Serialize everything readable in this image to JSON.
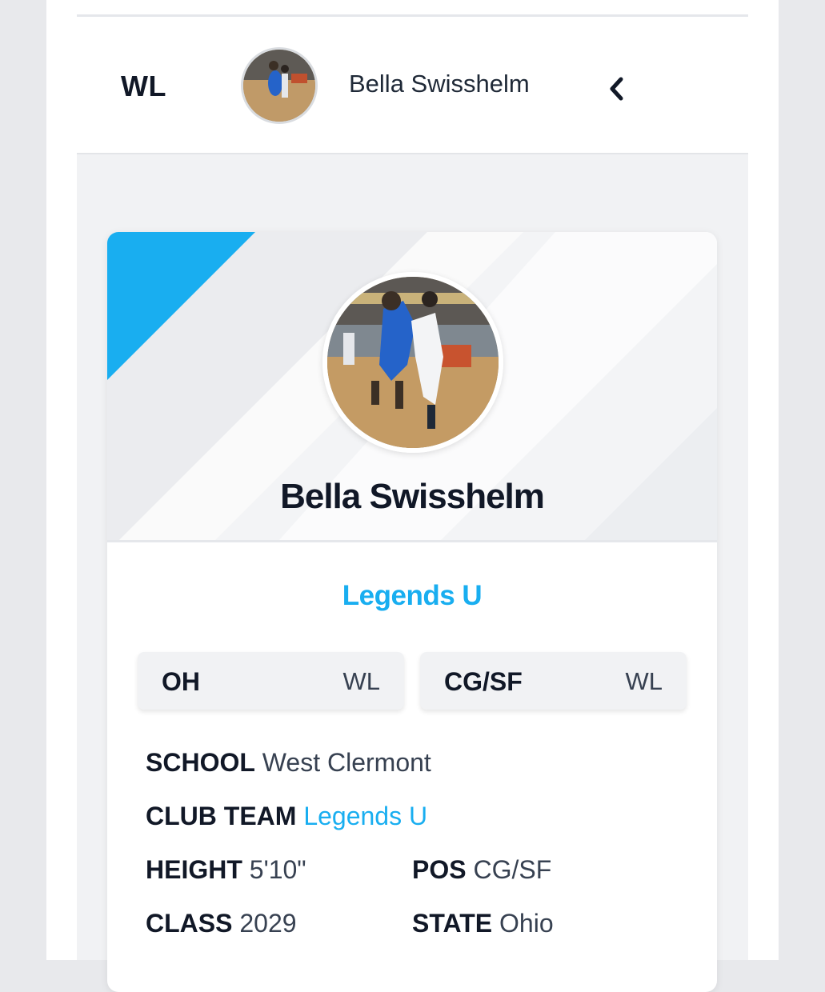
{
  "header": {
    "logo": "WL",
    "player_name": "Bella Swisshelm",
    "back_icon": "chevron-left-icon"
  },
  "profile": {
    "name": "Bella Swisshelm",
    "team": "Legends U",
    "accent_color": "#19aef0"
  },
  "chips": [
    {
      "label": "OH",
      "value": "WL"
    },
    {
      "label": "CG/SF",
      "value": "WL"
    }
  ],
  "info": {
    "school": {
      "key": "SCHOOL",
      "value": "West Clermont"
    },
    "club_team": {
      "key": "CLUB TEAM",
      "value": "Legends U"
    },
    "height": {
      "key": "HEIGHT",
      "value": "5'10\""
    },
    "pos": {
      "key": "POS",
      "value": "CG/SF"
    },
    "class": {
      "key": "CLASS",
      "value": "2029"
    },
    "state": {
      "key": "STATE",
      "value": "Ohio"
    }
  }
}
